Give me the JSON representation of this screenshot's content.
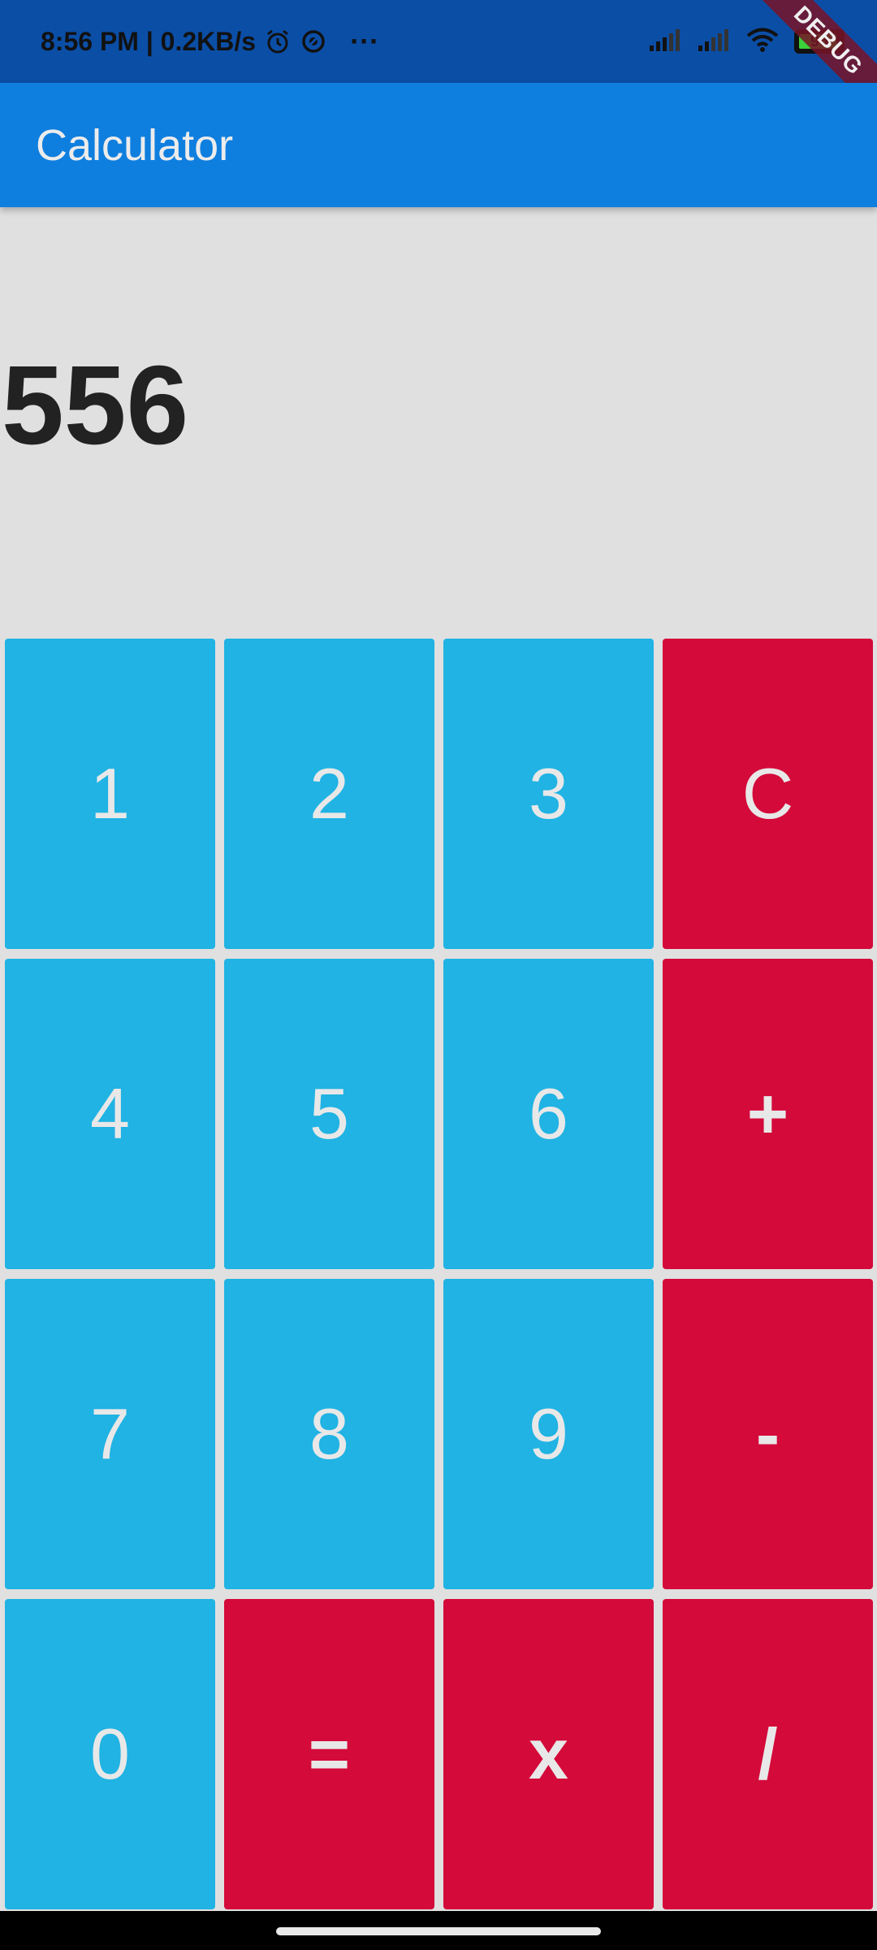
{
  "status_bar": {
    "time_speed": "8:56 PM | 0.2KB/s",
    "more": "···",
    "battery": "96",
    "debug_label": "DEBUG"
  },
  "app_bar": {
    "title": "Calculator"
  },
  "display": {
    "value": "556"
  },
  "keys": [
    {
      "label": "1"
    },
    {
      "label": "2"
    },
    {
      "label": "3"
    },
    {
      "label": "C"
    },
    {
      "label": "4"
    },
    {
      "label": "5"
    },
    {
      "label": "6"
    },
    {
      "label": "+"
    },
    {
      "label": "7"
    },
    {
      "label": "8"
    },
    {
      "label": "9"
    },
    {
      "label": "-"
    },
    {
      "label": "0"
    },
    {
      "label": "="
    },
    {
      "label": "x"
    },
    {
      "label": "/"
    }
  ],
  "colors": {
    "status_bar": "#0b4ea6",
    "app_bar": "#0f7fdf",
    "number_key": "#20b3e3",
    "operator_key": "#d40a3a",
    "background": "#e0e0e0"
  }
}
